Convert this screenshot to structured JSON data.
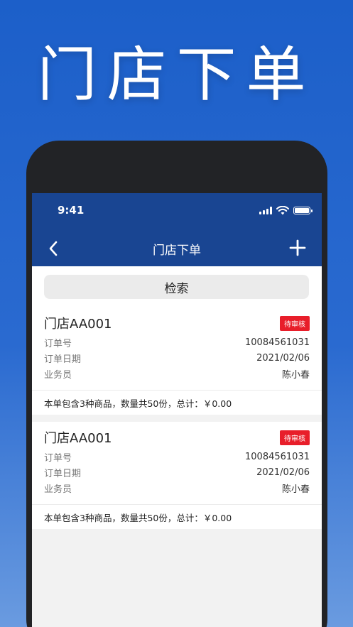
{
  "promo": {
    "title": "门店下单"
  },
  "status_bar": {
    "time": "9:41"
  },
  "nav": {
    "title": "门店下单",
    "back_icon": "chevron-left-icon",
    "add_icon": "plus-icon"
  },
  "search": {
    "label": "检索"
  },
  "orders": [
    {
      "store": "门店AA001",
      "status": "待审核",
      "fields": [
        {
          "label": "订单号",
          "value": "10084561031"
        },
        {
          "label": "订单日期",
          "value": "2021/02/06"
        },
        {
          "label": "业务员",
          "value": "陈小春"
        }
      ],
      "summary": "本单包含3种商品，数量共50份，总计：￥0.00"
    },
    {
      "store": "门店AA001",
      "status": "待审核",
      "fields": [
        {
          "label": "订单号",
          "value": "10084561031"
        },
        {
          "label": "订单日期",
          "value": "2021/02/06"
        },
        {
          "label": "业务员",
          "value": "陈小春"
        }
      ],
      "summary": "本单包含3种商品，数量共50份，总计：￥0.00"
    }
  ],
  "colors": {
    "header": "#194592",
    "badge": "#e81e2a",
    "background": "#1c5fc9"
  }
}
